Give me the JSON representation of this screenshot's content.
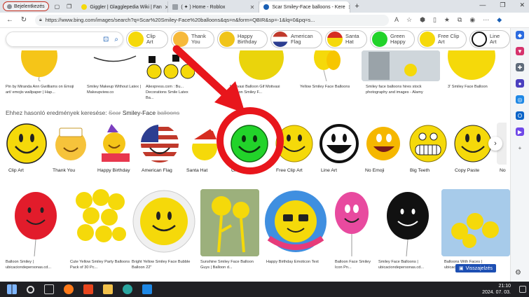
{
  "browser": {
    "profile_label": "Bejelentkezés",
    "tabs": [
      {
        "title": "Giggler | Glagglepedia Wiki | Fan",
        "active": false
      },
      {
        "title": "( ✦ ) Home - Roblox",
        "active": false
      },
      {
        "title": "Scar Smiley-Face balloons - Kere",
        "active": true
      }
    ],
    "url": "https://www.bing.com/images/search?q=Scar%20Smiley-Face%20balloons&qs=n&form=QBIR&sp=-1&lq=0&pq=s..."
  },
  "search": {
    "pills": [
      {
        "label": "Clip Art"
      },
      {
        "label": "Thank You"
      },
      {
        "label": "Happy Birthday"
      },
      {
        "label": "American Flag"
      },
      {
        "label": "Santa Hat"
      },
      {
        "label": "Green Happy"
      },
      {
        "label": "Free Clip Art"
      },
      {
        "label": "Line Art"
      }
    ]
  },
  "results_top": [
    {
      "caption": "Pin by Miranda Ann Gwilliams on Emoji art/ emojis wallpaper | Hap..."
    },
    {
      "caption": "Smiley Makeup Without Latex | Makeupview.co"
    },
    {
      "caption": "Aliexpress.com : Bu... Decorations Smile Latex Ba..."
    },
    {
      "caption": "Motivasi Balloon Gif Motivasi Balloon Smiley F..."
    },
    {
      "caption": "Yellow Smiley Face Balloons"
    },
    {
      "caption": "Smiley face balloons hires stock photography and images - Alamy"
    },
    {
      "caption": "3' Smiley Face Balloon"
    }
  ],
  "similar": {
    "prefix": "Ehhez hasonló eredmények keresése:",
    "struck1": "Scar",
    "term": "Smiley-Face",
    "struck2": "balloons",
    "chips": [
      {
        "label": "Clip Art"
      },
      {
        "label": "Thank You"
      },
      {
        "label": "Happy Birthday"
      },
      {
        "label": "American Flag"
      },
      {
        "label": "Santa Hat"
      },
      {
        "label": "Green Happy"
      },
      {
        "label": "Free Clip Art"
      },
      {
        "label": "Line Art"
      },
      {
        "label": "No Emoji"
      },
      {
        "label": "Big Teeth"
      },
      {
        "label": "Copy Paste"
      },
      {
        "label": "No"
      }
    ]
  },
  "results_bottom": [
    {
      "caption": "Balloon Smiley | ubicaciondepersonas.cd..."
    },
    {
      "caption": "Cute Yellow Smiley Party Balloons Pack of 30 Pc..."
    },
    {
      "caption": "Bright Yellow Smiley Face Bubble Balloon 22\""
    },
    {
      "caption": "Sunshine Smiley Face Balloon Guys | Balloon d..."
    },
    {
      "caption": "Happy Birthday Emoticon Text"
    },
    {
      "caption": "Balloon Face Smiley Icon Pn..."
    },
    {
      "caption": "Smiley Face Balloons | ubicaciondepersonas.cd..."
    },
    {
      "caption": "Balloons With Faces | ubicaciondepersonas..."
    }
  ],
  "feedback_label": "Visszajelzés",
  "taskbar": {
    "time": "21:10",
    "date": "2024. 07. 03."
  },
  "colors": {
    "annotation_red": "#e8161c",
    "smiley_yellow": "#f5d90a",
    "green_smiley": "#22d32a",
    "bing_blue": "#1a5fb4"
  }
}
